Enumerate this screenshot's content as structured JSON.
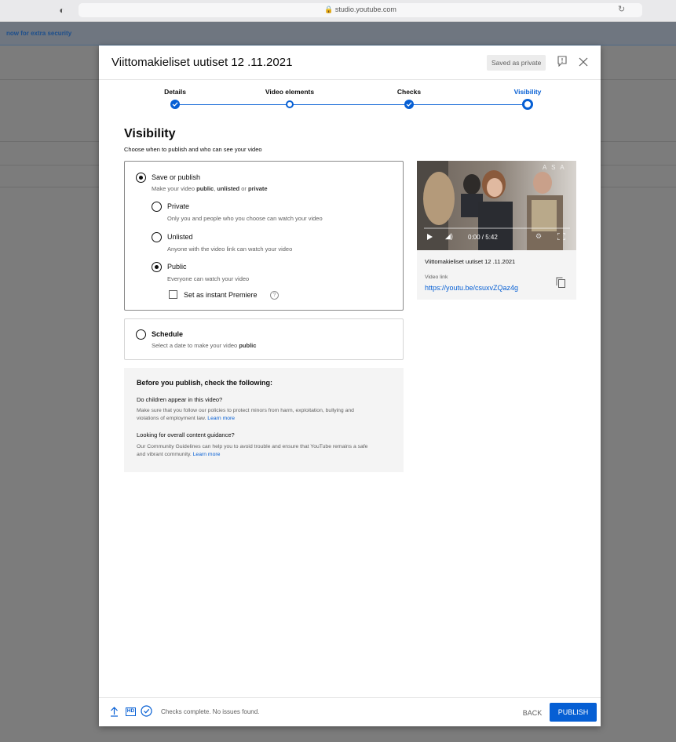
{
  "browser": {
    "url": "studio.youtube.com"
  },
  "background": {
    "banner_text": "now for extra security"
  },
  "dialog": {
    "title": "Viittomakieliset uutiset 12 .11.2021",
    "saved_badge": "Saved as private",
    "steps": [
      {
        "label": "Details",
        "state": "done"
      },
      {
        "label": "Video elements",
        "state": "visited"
      },
      {
        "label": "Checks",
        "state": "done"
      },
      {
        "label": "Visibility",
        "state": "current"
      }
    ],
    "accent_color": "#065fd4"
  },
  "visibility": {
    "title": "Visibility",
    "subtitle": "Choose when to publish and who can see your video",
    "save_or_publish": {
      "label": "Save or publish",
      "desc_prefix": "Make your video ",
      "desc_public": "public",
      "desc_sep": ", ",
      "desc_unlisted": "unlisted",
      "desc_or": " or ",
      "desc_private": "private",
      "selected": true
    },
    "options": [
      {
        "label": "Private",
        "desc": "Only you and people who you choose can watch your video",
        "selected": false
      },
      {
        "label": "Unlisted",
        "desc": "Anyone with the video link can watch your video",
        "selected": false
      },
      {
        "label": "Public",
        "desc": "Everyone can watch your video",
        "selected": true
      }
    ],
    "premiere": {
      "label": "Set as instant Premiere",
      "checked": false,
      "help_glyph": "?"
    },
    "schedule": {
      "label": "Schedule",
      "desc_prefix": "Select a date to make your video ",
      "desc_bold": "public",
      "selected": false
    }
  },
  "checklist": {
    "title": "Before you publish, check the following:",
    "q1": "Do children appear in this video?",
    "t1": "Make sure that you follow our policies to protect minors from harm, exploitation, bullying and violations of employment law.",
    "q2": "Looking for overall content guidance?",
    "t2": "Our Community Guidelines can help you to avoid trouble and ensure that YouTube remains a safe and vibrant community.",
    "learn_more": "Learn more"
  },
  "video": {
    "time": "0:00 / 5:42",
    "brand_mark": "A S A",
    "title": "Viittomakieliset uutiset 12 .11.2021",
    "link_label": "Video link",
    "link": "https://youtu.be/csuxvZQaz4g"
  },
  "footer": {
    "hd_label": "HD",
    "status": "Checks complete. No issues found.",
    "back": "BACK",
    "publish": "PUBLISH"
  }
}
